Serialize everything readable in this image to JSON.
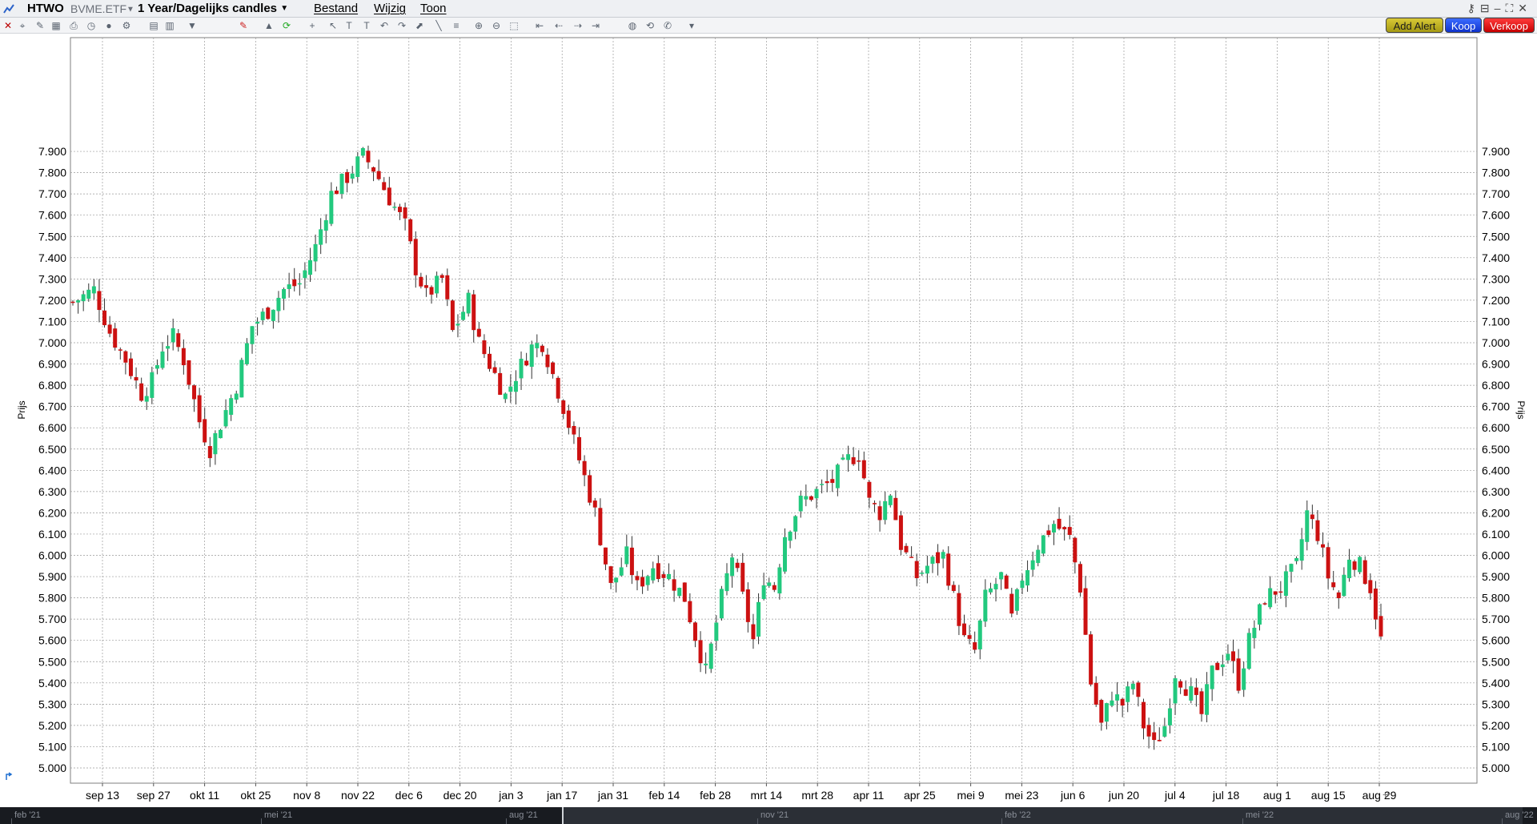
{
  "window": {
    "symbol": "HTWO",
    "exchange": "BVME.ETF",
    "period": "1 Year/Dagelijks candles",
    "menu": [
      "Bestand",
      "Wijzig",
      "Toon"
    ]
  },
  "toolbar": {
    "add_alert": "Add Alert",
    "buy": "Koop",
    "sell": "Verkoop"
  },
  "colors": {
    "up": "#22c97e",
    "down": "#cc1111",
    "grid": "#9a9a9a",
    "alert_button": "#c9bb25",
    "buy_button": "#1f47f0",
    "sell_button": "#e61010"
  },
  "navigator": {
    "labels": [
      "feb '21",
      "mei '21",
      "aug '21",
      "nov '21",
      "feb '22",
      "mei '22",
      "aug '22"
    ]
  },
  "chart_data": {
    "type": "candlestick",
    "ylabel": "Prijs",
    "ylim": [
      4.96,
      7.95
    ],
    "yticks": [
      "7.900",
      "7.800",
      "7.700",
      "7.600",
      "7.500",
      "7.400",
      "7.300",
      "7.200",
      "7.100",
      "7.000",
      "6.900",
      "6.800",
      "6.700",
      "6.600",
      "6.500",
      "6.400",
      "6.300",
      "6.200",
      "6.100",
      "6.000",
      "5.900",
      "5.800",
      "5.700",
      "5.600",
      "5.500",
      "5.400",
      "5.300",
      "5.200",
      "5.100",
      "5.000"
    ],
    "xticks": [
      "sep 13",
      "sep 27",
      "okt 11",
      "okt 25",
      "nov 8",
      "nov 22",
      "dec 6",
      "dec 20",
      "jan 3",
      "jan 17",
      "jan 31",
      "feb 14",
      "feb 28",
      "mrt 14",
      "mrt 28",
      "apr 11",
      "apr 25",
      "mei 9",
      "mei 23",
      "jun 6",
      "jun 20",
      "jul 4",
      "jul 18",
      "aug 1",
      "aug 15",
      "aug 29"
    ],
    "grid": true,
    "anchors": [
      [
        0,
        7.19
      ],
      [
        4,
        7.25
      ],
      [
        7,
        7.05
      ],
      [
        10,
        6.92
      ],
      [
        13,
        6.76
      ],
      [
        15,
        6.82
      ],
      [
        17,
        6.98
      ],
      [
        19,
        7.03
      ],
      [
        21,
        6.92
      ],
      [
        24,
        6.63
      ],
      [
        26,
        6.5
      ],
      [
        28,
        6.62
      ],
      [
        31,
        6.8
      ],
      [
        34,
        7.08
      ],
      [
        37,
        7.15
      ],
      [
        40,
        7.25
      ],
      [
        43,
        7.28
      ],
      [
        46,
        7.45
      ],
      [
        49,
        7.7
      ],
      [
        52,
        7.78
      ],
      [
        55,
        7.88
      ],
      [
        57,
        7.82
      ],
      [
        60,
        7.68
      ],
      [
        63,
        7.55
      ],
      [
        65,
        7.35
      ],
      [
        67,
        7.22
      ],
      [
        70,
        7.3
      ],
      [
        72,
        7.05
      ],
      [
        75,
        7.2
      ],
      [
        77,
        7.0
      ],
      [
        80,
        6.85
      ],
      [
        82,
        6.75
      ],
      [
        84,
        6.85
      ],
      [
        87,
        6.98
      ],
      [
        89,
        7.0
      ],
      [
        91,
        6.85
      ],
      [
        93,
        6.7
      ],
      [
        96,
        6.45
      ],
      [
        99,
        6.2
      ],
      [
        102,
        5.85
      ],
      [
        105,
        6.0
      ],
      [
        107,
        5.85
      ],
      [
        110,
        5.95
      ],
      [
        113,
        5.9
      ],
      [
        116,
        5.8
      ],
      [
        118,
        5.62
      ],
      [
        120,
        5.45
      ],
      [
        123,
        5.8
      ],
      [
        125,
        6.0
      ],
      [
        127,
        5.8
      ],
      [
        129,
        5.6
      ],
      [
        131,
        5.9
      ],
      [
        133,
        5.85
      ],
      [
        135,
        6.1
      ],
      [
        138,
        6.25
      ],
      [
        141,
        6.3
      ],
      [
        144,
        6.35
      ],
      [
        147,
        6.45
      ],
      [
        149,
        6.48
      ],
      [
        151,
        6.25
      ],
      [
        153,
        6.2
      ],
      [
        155,
        6.3
      ],
      [
        157,
        6.05
      ],
      [
        160,
        5.9
      ],
      [
        162,
        5.95
      ],
      [
        165,
        6.0
      ],
      [
        167,
        5.8
      ],
      [
        169,
        5.6
      ],
      [
        171,
        5.55
      ],
      [
        173,
        5.8
      ],
      [
        176,
        5.9
      ],
      [
        178,
        5.7
      ],
      [
        180,
        5.9
      ],
      [
        183,
        6.05
      ],
      [
        186,
        6.15
      ],
      [
        189,
        6.08
      ],
      [
        191,
        5.85
      ],
      [
        193,
        5.4
      ],
      [
        195,
        5.2
      ],
      [
        197,
        5.35
      ],
      [
        199,
        5.3
      ],
      [
        201,
        5.4
      ],
      [
        203,
        5.2
      ],
      [
        205,
        5.1
      ],
      [
        207,
        5.2
      ],
      [
        209,
        5.45
      ],
      [
        212,
        5.35
      ],
      [
        214,
        5.25
      ],
      [
        216,
        5.45
      ],
      [
        219,
        5.55
      ],
      [
        221,
        5.4
      ],
      [
        223,
        5.6
      ],
      [
        226,
        5.8
      ],
      [
        229,
        5.85
      ],
      [
        232,
        5.95
      ],
      [
        234,
        6.2
      ],
      [
        236,
        6.1
      ],
      [
        238,
        5.9
      ],
      [
        240,
        5.8
      ],
      [
        242,
        6.0
      ],
      [
        244,
        5.95
      ],
      [
        246,
        5.85
      ],
      [
        248,
        5.6
      ]
    ]
  }
}
